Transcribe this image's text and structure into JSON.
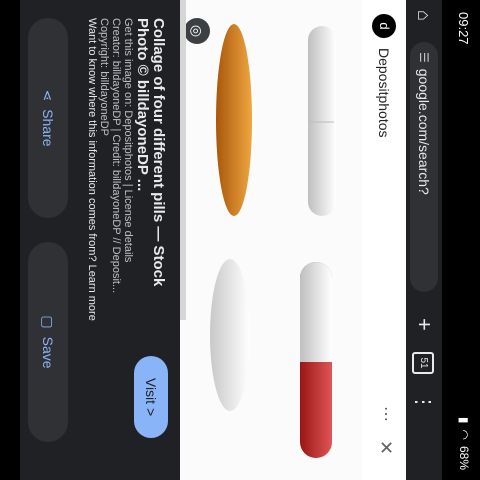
{
  "status": {
    "time": "09:27",
    "battery": "68%"
  },
  "urlbar": {
    "url": "google.com/search?",
    "tab_count": "51"
  },
  "source": {
    "name": "Depositphotos"
  },
  "info": {
    "title": "Collage of four different pills — Stock Photo © billdayoneDP ...",
    "visit_label": "Visit >",
    "lines": [
      "Get this image on: Depositphotos | License details",
      "Creator: billdayoneDP | Credit: billdayoneDP // Deposit...",
      "Copyright: billdayoneDP",
      "Want to know where this information comes from? Learn more"
    ]
  },
  "actions": {
    "share_label": "Share",
    "save_label": "Save"
  },
  "icons": {
    "home": "home-icon",
    "tune": "tune-icon",
    "plus": "plus-icon",
    "tabs": "tabs-icon",
    "menu": "menu-icon",
    "lens": "lens-icon",
    "close": "close-icon",
    "share": "share-icon",
    "save": "bookmark-icon"
  }
}
